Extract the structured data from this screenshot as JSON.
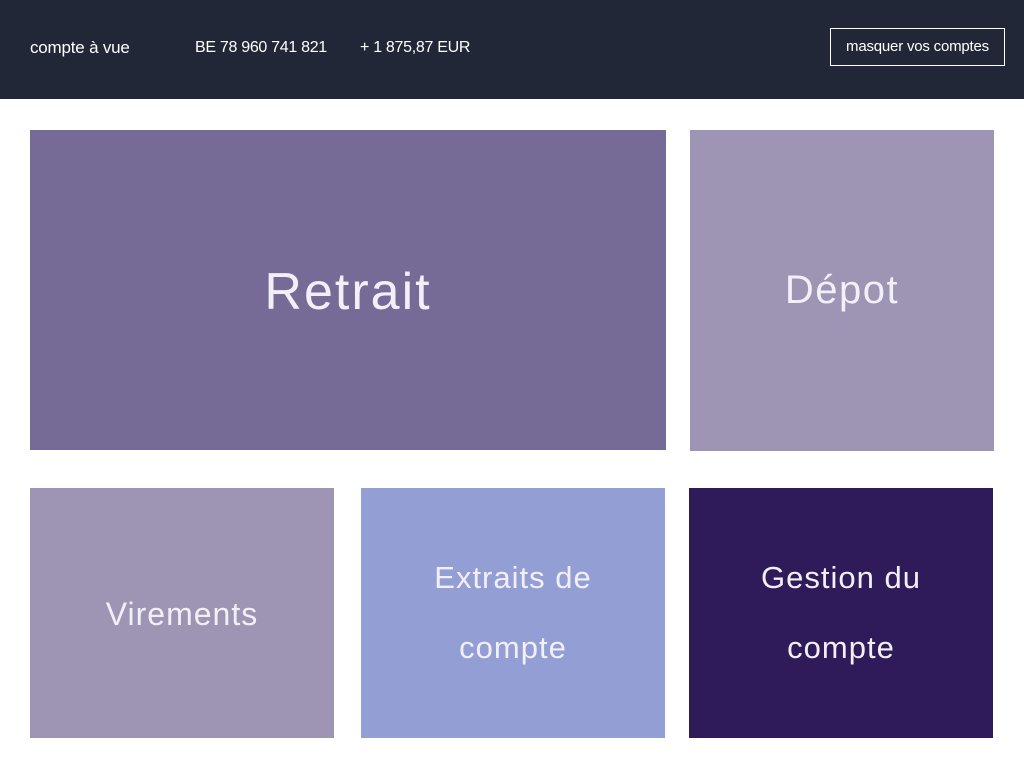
{
  "header": {
    "account_name": "compte à vue",
    "iban": "BE 78 960 741 821",
    "balance": "+ 1 875,87 EUR",
    "hide_accounts_label": "masquer vos comptes"
  },
  "tiles": {
    "retrait": {
      "label": "Retrait",
      "color": "#766a96"
    },
    "depot": {
      "label": "Dépot",
      "color": "#9e95b5"
    },
    "virements": {
      "label": "Virements",
      "color": "#9e95b5"
    },
    "extraits": {
      "line1": "Extraits de",
      "line2": "compte",
      "color": "#939ed4"
    },
    "gestion": {
      "line1": "Gestion du",
      "line2": "compte",
      "color": "#2f1b59"
    }
  },
  "colors": {
    "header_bg": "#212736",
    "tile_text": "#f2eff6"
  }
}
